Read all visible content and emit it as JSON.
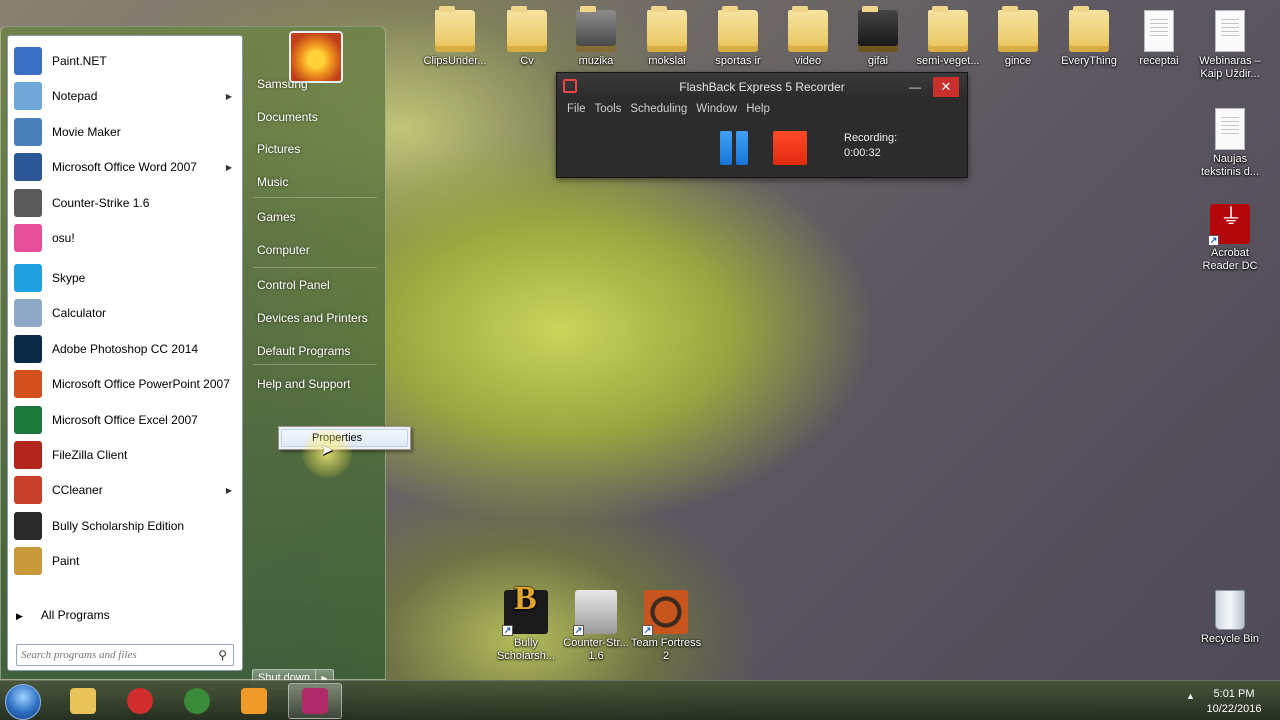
{
  "desktop": {
    "top_icons": [
      {
        "label": "ClipsUnder...",
        "kind": "folder"
      },
      {
        "label": "Cv",
        "kind": "folder"
      },
      {
        "label": "muzika",
        "kind": "folder-img"
      },
      {
        "label": "mokslai",
        "kind": "folder"
      },
      {
        "label": "sportas ir",
        "kind": "folder"
      },
      {
        "label": "video",
        "kind": "folder"
      },
      {
        "label": "gifai",
        "kind": "folder-dark"
      },
      {
        "label": "semi-veget...",
        "kind": "folder"
      },
      {
        "label": "gince",
        "kind": "folder"
      },
      {
        "label": "EveryThing",
        "kind": "folder"
      },
      {
        "label": "receptai",
        "kind": "document"
      },
      {
        "label": "Webinaras – Kaip Uždir...",
        "kind": "document"
      }
    ],
    "right_icons": [
      {
        "label": "Naujas tekstinis d...",
        "kind": "document"
      },
      {
        "label": "Acrobat Reader DC",
        "kind": "acrobat-shortcut"
      },
      {
        "label": "Recycle Bin",
        "kind": "recycle-bin"
      }
    ],
    "bottom_icons": [
      {
        "label": "Bully Scholarsh...",
        "kind": "bully-shortcut"
      },
      {
        "label": "Counter-Str... 1.6",
        "kind": "cs-shortcut"
      },
      {
        "label": "Team Fortress 2",
        "kind": "tf2-shortcut"
      }
    ]
  },
  "start_menu": {
    "programs": [
      {
        "label": "Paint.NET",
        "icon": "paintnet-icon",
        "color": "#3a6fc4",
        "has_submenu": false
      },
      {
        "label": "Notepad",
        "icon": "notepad-icon",
        "color": "#6fa7d8",
        "has_submenu": true
      },
      {
        "label": "Movie Maker",
        "icon": "movie-maker-icon",
        "color": "#4a7fb8",
        "has_submenu": false
      },
      {
        "label": "Microsoft Office Word 2007",
        "icon": "word-icon",
        "color": "#2b5797",
        "has_submenu": true
      },
      {
        "label": "Counter-Strike 1.6",
        "icon": "counter-strike-icon",
        "color": "#5a5a5a",
        "has_submenu": false
      },
      {
        "label": "osu!",
        "icon": "osu-icon",
        "color": "#e84f9a",
        "has_submenu": false
      },
      {
        "label": "Skype",
        "icon": "skype-icon",
        "color": "#1fa0e0",
        "has_submenu": false
      },
      {
        "label": "Calculator",
        "icon": "calculator-icon",
        "color": "#8fa8c8",
        "has_submenu": false
      },
      {
        "label": "Adobe Photoshop CC 2014",
        "icon": "photoshop-icon",
        "color": "#0b2a47",
        "has_submenu": false
      },
      {
        "label": "Microsoft Office PowerPoint 2007",
        "icon": "powerpoint-icon",
        "color": "#d2501e",
        "has_submenu": false
      },
      {
        "label": "Microsoft Office Excel 2007",
        "icon": "excel-icon",
        "color": "#1e7a3c",
        "has_submenu": false
      },
      {
        "label": "FileZilla Client",
        "icon": "filezilla-icon",
        "color": "#b3261e",
        "has_submenu": false
      },
      {
        "label": "CCleaner",
        "icon": "ccleaner-icon",
        "color": "#c8402a",
        "has_submenu": true
      },
      {
        "label": "Bully Scholarship Edition",
        "icon": "bully-icon",
        "color": "#2a2a2a",
        "has_submenu": false
      },
      {
        "label": "Paint",
        "icon": "paint-icon",
        "color": "#c89a3a",
        "has_submenu": false
      }
    ],
    "all_programs": "All Programs",
    "search_placeholder": "Search programs and files",
    "right_items": [
      "Samsung",
      "Documents",
      "Pictures",
      "Music",
      "Games",
      "Computer",
      "Control Panel",
      "Devices and Printers",
      "Default Programs",
      "Help and Support"
    ],
    "shutdown_label": "Shut down"
  },
  "context_menu": {
    "item": "Properties"
  },
  "flashback": {
    "title": "FlashBack Express 5 Recorder",
    "menu": [
      "File",
      "Tools",
      "Scheduling",
      "Window",
      "Help"
    ],
    "recording_label": "Recording:",
    "recording_time": "0:00:32",
    "close_glyph": "✕",
    "minimize_glyph": "—"
  },
  "taskbar": {
    "pinned": [
      {
        "name": "explorer",
        "icon": "folder-icon",
        "color": "#e8c35a",
        "active": false
      },
      {
        "name": "opera",
        "icon": "opera-icon",
        "color": "#d12d2d",
        "active": false
      },
      {
        "name": "chrome",
        "icon": "chrome-icon",
        "color": "#3b8a3a",
        "active": false
      },
      {
        "name": "media",
        "icon": "media-player-icon",
        "color": "#f09a2a",
        "active": false
      },
      {
        "name": "flashback",
        "icon": "flashback-recorder-icon",
        "color": "#b02a6a",
        "active": true
      }
    ],
    "time": "5:01 PM",
    "date": "10/22/2016"
  },
  "colors": {
    "record_stop": "#e02a10",
    "pause": "#1873d8",
    "close_button": "#c9302c"
  }
}
